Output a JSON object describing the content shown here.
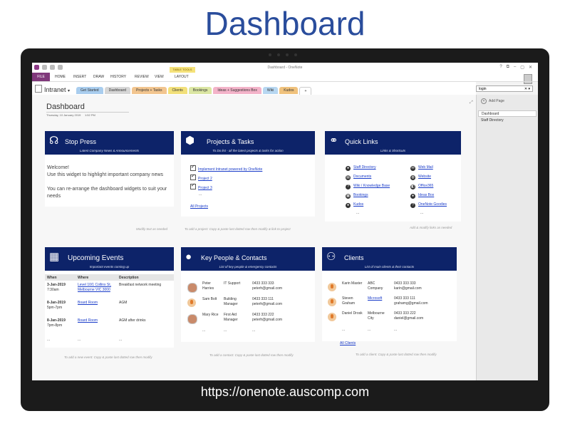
{
  "header": {
    "title": "Dashboard",
    "url": "https://onenote.auscomp.com"
  },
  "window": {
    "title": "Dashboard - OneNote",
    "menu": [
      "FILE",
      "HOME",
      "INSERT",
      "DRAW",
      "HISTORY",
      "REVIEW",
      "VIEW",
      "LAYOUT"
    ],
    "context_tab": "TABLE TOOLS",
    "controls": [
      "?",
      "⧉",
      "–",
      "▢",
      "✕"
    ]
  },
  "notebook": {
    "name": "Intranet",
    "sections": [
      {
        "label": "Get Started",
        "color": "#a9cdee"
      },
      {
        "label": "Dashboard",
        "color": "#d6d6d6"
      },
      {
        "label": "Projects + Tasks",
        "color": "#f2c58f"
      },
      {
        "label": "Clients",
        "color": "#f2e07a"
      },
      {
        "label": "Bookings",
        "color": "#dbe6a3"
      },
      {
        "label": "Ideas + Suggestions Box",
        "color": "#f3b3c9"
      },
      {
        "label": "Wiki",
        "color": "#b7d7f1"
      },
      {
        "label": "Kudos",
        "color": "#f0c27d"
      },
      {
        "label": "+",
        "color": "#ffffff"
      }
    ],
    "search_value": "login"
  },
  "pages_pane": {
    "add_page": "Add Page",
    "pages": [
      "Dashboard",
      "Staff Directory"
    ]
  },
  "page": {
    "title": "Dashboard",
    "date": "Thursday, 10 January 2019",
    "time": "1:52 PM"
  },
  "stop_press": {
    "title": "Stop Press",
    "subtitle": "Latest Company News & Announcements",
    "line1": "Welcome!",
    "line2": "Use this widget to highlight important company news",
    "line3": "You can re-arrange the dashboard widgets to suit your needs",
    "note": "Modify text as needed"
  },
  "projects": {
    "title": "Projects & Tasks",
    "subtitle": "To Do list - all the latest projects & tasks for action",
    "items": [
      "Implement Intranet powered by OneNote",
      "Project 2",
      "Project 3"
    ],
    "ellipsis": "...",
    "all_link": "All Projects",
    "note": "To add a project: Copy & paste last dotted row then modify & link to project"
  },
  "quick_links": {
    "title": "Quick Links",
    "subtitle": "Links & Shortcuts",
    "left": [
      "Staff Directory",
      "Documents",
      "Wiki / Knowledge Base",
      "Bookings",
      "Kudos"
    ],
    "right": [
      "Web Mail",
      "Website",
      "Office365",
      "Ideas Box",
      "OneNote Goodies"
    ],
    "ellipsis": "...",
    "note": "Add & modify links as needed"
  },
  "events": {
    "title": "Upcoming Events",
    "subtitle": "Important events coming up",
    "headers": [
      "When",
      "Where",
      "Description"
    ],
    "rows": [
      {
        "when1": "3-Jan-2019",
        "when2": "7:30am",
        "where1": "Level 10/1 Collins St,",
        "where2": "Melbourne VIC 3000",
        "desc": "Breakfast network meeting"
      },
      {
        "when1": "8-Jan-2019",
        "when2": "5pm-7pm",
        "where1": "Board Room",
        "where2": "",
        "desc": "AGM"
      },
      {
        "when1": "8-Jan-2019",
        "when2": "7pm-8pm",
        "where1": "Board Room",
        "where2": "",
        "desc": "AGM after drinks"
      }
    ],
    "ellipsis": "...",
    "note": "To add a new event: Copy & paste last dotted row then modify"
  },
  "contacts": {
    "title": "Key People & Contacts",
    "subtitle": "List of key people & emergency contacts",
    "rows": [
      {
        "name1": "Peter",
        "name2": "Harries",
        "role1": "IT Support",
        "role2": "",
        "phone": "0433 333 333",
        "email": "peterh@gmail.com"
      },
      {
        "name1": "Sam Bolt",
        "name2": "",
        "role1": "Building",
        "role2": "Manager",
        "phone": "0433 333 111",
        "email": "peterh@gmail.com"
      },
      {
        "name1": "Mary Rice",
        "name2": "",
        "role1": "First Aid",
        "role2": "Manager",
        "phone": "0433 333 222",
        "email": "peterh@gmail.com"
      }
    ],
    "ellipsis": "...",
    "note": "To add a contact: Copy & paste last dotted row then modify"
  },
  "clients": {
    "title": "Clients",
    "subtitle": "List of main clients & their contacts",
    "rows": [
      {
        "name1": "Karin Master",
        "name2": "",
        "co1": "ABC",
        "co2": "Company",
        "phone": "0433 333 333",
        "email": "karin@gmail.com"
      },
      {
        "name1": "Steven",
        "name2": "Graham",
        "co1": "Microsoft",
        "co2": "",
        "phone": "0433 333 111",
        "email": "grahamg@gmail.com"
      },
      {
        "name1": "Daniel Drosk",
        "name2": "",
        "co1": "Melbourne",
        "co2": "City",
        "phone": "0433 333 222",
        "email": "daniel@gmail.com"
      }
    ],
    "ellipsis": "...",
    "all_link": "All Clients",
    "note": "To add a client: Copy & paste last dotted row then modify"
  },
  "colors": {
    "widget_header": "#0d2369",
    "link": "#1a3cc9",
    "title_blue": "#2a4d9c"
  }
}
